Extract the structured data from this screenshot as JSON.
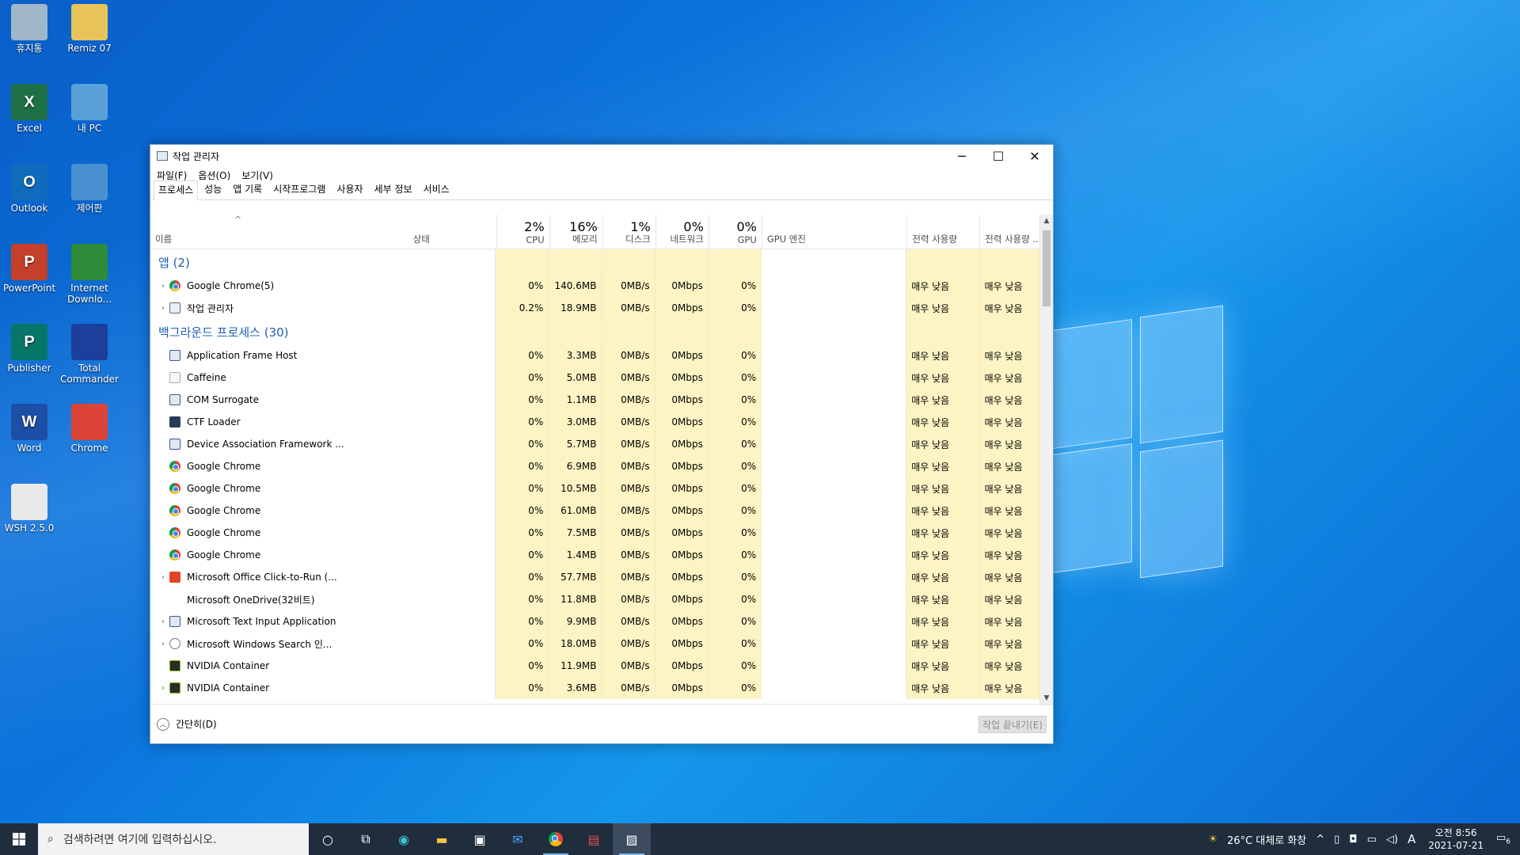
{
  "desktop": {
    "icons": [
      {
        "label": "휴지통",
        "icon": "recycle-bin-icon",
        "color": "#9fb7c9"
      },
      {
        "label": "Remiz 07",
        "icon": "user-folder-icon",
        "color": "#e8c35a"
      },
      {
        "label": "Excel",
        "icon": "excel-icon",
        "color": "#1e7145",
        "glyph": "X"
      },
      {
        "label": "내 PC",
        "icon": "this-pc-icon",
        "color": "#5aa0d8"
      },
      {
        "label": "Outlook",
        "icon": "outlook-icon",
        "color": "#0f6cbd",
        "glyph": "O"
      },
      {
        "label": "제어판",
        "icon": "control-panel-icon",
        "color": "#4a8fd0"
      },
      {
        "label": "PowerPoint",
        "icon": "powerpoint-icon",
        "color": "#c4402a",
        "glyph": "P"
      },
      {
        "label": "Internet Downlo...",
        "icon": "internet-download-manager-icon",
        "color": "#2e8b3a"
      },
      {
        "label": "Publisher",
        "icon": "publisher-icon",
        "color": "#077568",
        "glyph": "P"
      },
      {
        "label": "Total Commander",
        "icon": "total-commander-icon",
        "color": "#1b3f9a"
      },
      {
        "label": "Word",
        "icon": "word-icon",
        "color": "#1e4fa6",
        "glyph": "W"
      },
      {
        "label": "Chrome",
        "icon": "chrome-icon",
        "color": "#db4437"
      },
      {
        "label": "WSH 2.5.0",
        "icon": "file-icon",
        "color": "#e9e9e9"
      }
    ]
  },
  "window": {
    "title": "작업 관리자",
    "controls": {
      "minimize": "─",
      "maximize": "☐",
      "close": "✕"
    },
    "menu": [
      "파일(F)",
      "옵션(O)",
      "보기(V)"
    ],
    "tabs": [
      "프로세스",
      "성능",
      "앱 기록",
      "시작프로그램",
      "사용자",
      "세부 정보",
      "서비스"
    ],
    "active_tab": "프로세스",
    "columns": {
      "name": "이름",
      "status": "상태",
      "cpu": {
        "pct": "2%",
        "label": "CPU"
      },
      "memory": {
        "pct": "16%",
        "label": "메모리"
      },
      "disk": {
        "pct": "1%",
        "label": "디스크"
      },
      "network": {
        "pct": "0%",
        "label": "네트워크"
      },
      "gpu": {
        "pct": "0%",
        "label": "GPU"
      },
      "gpu_engine": "GPU 엔진",
      "power": "전력 사용량",
      "power_trend": "전력 사용량 ..."
    },
    "groups": {
      "apps": "앱 (2)",
      "background": "백그라운드 프로세스 (30)"
    },
    "apps": [
      {
        "name": "Google Chrome(5)",
        "icon": "chrome",
        "expand": true,
        "cpu": "0%",
        "mem": "140.6MB",
        "disk": "0MB/s",
        "net": "0Mbps",
        "gpu": "0%",
        "p1": "매우 낮음",
        "p2": "매우 낮음"
      },
      {
        "name": "작업 관리자",
        "icon": "tm",
        "expand": true,
        "cpu": "0.2%",
        "mem": "18.9MB",
        "disk": "0MB/s",
        "net": "0Mbps",
        "gpu": "0%",
        "p1": "매우 낮음",
        "p2": "매우 낮음"
      }
    ],
    "background": [
      {
        "name": "Application Frame Host",
        "icon": "app",
        "expand": false,
        "cpu": "0%",
        "mem": "3.3MB",
        "disk": "0MB/s",
        "net": "0Mbps",
        "gpu": "0%",
        "p1": "매우 낮음",
        "p2": "매우 낮음"
      },
      {
        "name": "Caffeine",
        "icon": "caffeine",
        "expand": false,
        "cpu": "0%",
        "mem": "5.0MB",
        "disk": "0MB/s",
        "net": "0Mbps",
        "gpu": "0%",
        "p1": "매우 낮음",
        "p2": "매우 낮음"
      },
      {
        "name": "COM Surrogate",
        "icon": "app",
        "expand": false,
        "cpu": "0%",
        "mem": "1.1MB",
        "disk": "0MB/s",
        "net": "0Mbps",
        "gpu": "0%",
        "p1": "매우 낮음",
        "p2": "매우 낮음"
      },
      {
        "name": "CTF Loader",
        "icon": "edit",
        "expand": false,
        "cpu": "0%",
        "mem": "3.0MB",
        "disk": "0MB/s",
        "net": "0Mbps",
        "gpu": "0%",
        "p1": "매우 낮음",
        "p2": "매우 낮음"
      },
      {
        "name": "Device Association Framework ...",
        "icon": "app",
        "expand": false,
        "cpu": "0%",
        "mem": "5.7MB",
        "disk": "0MB/s",
        "net": "0Mbps",
        "gpu": "0%",
        "p1": "매우 낮음",
        "p2": "매우 낮음"
      },
      {
        "name": "Google Chrome",
        "icon": "chrome",
        "expand": false,
        "cpu": "0%",
        "mem": "6.9MB",
        "disk": "0MB/s",
        "net": "0Mbps",
        "gpu": "0%",
        "p1": "매우 낮음",
        "p2": "매우 낮음"
      },
      {
        "name": "Google Chrome",
        "icon": "chrome",
        "expand": false,
        "cpu": "0%",
        "mem": "10.5MB",
        "disk": "0MB/s",
        "net": "0Mbps",
        "gpu": "0%",
        "p1": "매우 낮음",
        "p2": "매우 낮음"
      },
      {
        "name": "Google Chrome",
        "icon": "chrome",
        "expand": false,
        "cpu": "0%",
        "mem": "61.0MB",
        "disk": "0MB/s",
        "net": "0Mbps",
        "gpu": "0%",
        "p1": "매우 낮음",
        "p2": "매우 낮음"
      },
      {
        "name": "Google Chrome",
        "icon": "chrome",
        "expand": false,
        "cpu": "0%",
        "mem": "7.5MB",
        "disk": "0MB/s",
        "net": "0Mbps",
        "gpu": "0%",
        "p1": "매우 낮음",
        "p2": "매우 낮음"
      },
      {
        "name": "Google Chrome",
        "icon": "chrome",
        "expand": false,
        "cpu": "0%",
        "mem": "1.4MB",
        "disk": "0MB/s",
        "net": "0Mbps",
        "gpu": "0%",
        "p1": "매우 낮음",
        "p2": "매우 낮음"
      },
      {
        "name": "Microsoft Office Click-to-Run (...",
        "icon": "office",
        "expand": true,
        "cpu": "0%",
        "mem": "57.7MB",
        "disk": "0MB/s",
        "net": "0Mbps",
        "gpu": "0%",
        "p1": "매우 낮음",
        "p2": "매우 낮음"
      },
      {
        "name": "Microsoft OneDrive(32비트)",
        "icon": "none",
        "expand": false,
        "cpu": "0%",
        "mem": "11.8MB",
        "disk": "0MB/s",
        "net": "0Mbps",
        "gpu": "0%",
        "p1": "매우 낮음",
        "p2": "매우 낮음"
      },
      {
        "name": "Microsoft Text Input Application",
        "icon": "app",
        "expand": true,
        "cpu": "0%",
        "mem": "9.9MB",
        "disk": "0MB/s",
        "net": "0Mbps",
        "gpu": "0%",
        "p1": "매우 낮음",
        "p2": "매우 낮음"
      },
      {
        "name": "Microsoft Windows Search 인...",
        "icon": "search",
        "expand": true,
        "cpu": "0%",
        "mem": "18.0MB",
        "disk": "0MB/s",
        "net": "0Mbps",
        "gpu": "0%",
        "p1": "매우 낮음",
        "p2": "매우 낮음"
      },
      {
        "name": "NVIDIA Container",
        "icon": "nv",
        "expand": false,
        "cpu": "0%",
        "mem": "11.9MB",
        "disk": "0MB/s",
        "net": "0Mbps",
        "gpu": "0%",
        "p1": "매우 낮음",
        "p2": "매우 낮음"
      },
      {
        "name": "NVIDIA Container",
        "icon": "nv",
        "expand": true,
        "cpu": "0%",
        "mem": "3.6MB",
        "disk": "0MB/s",
        "net": "0Mbps",
        "gpu": "0%",
        "p1": "매우 낮음",
        "p2": "매우 낮음"
      }
    ],
    "footer": {
      "fewer_details": "간단히(D)",
      "end_task": "작업 끝내기(E)"
    }
  },
  "taskbar": {
    "search_placeholder": "검색하려면 여기에 입력하십시오.",
    "weather": "26°C  대체로 화창",
    "ime": "A",
    "time": "오전 8:56",
    "date": "2021-07-21",
    "notifications": "6"
  }
}
